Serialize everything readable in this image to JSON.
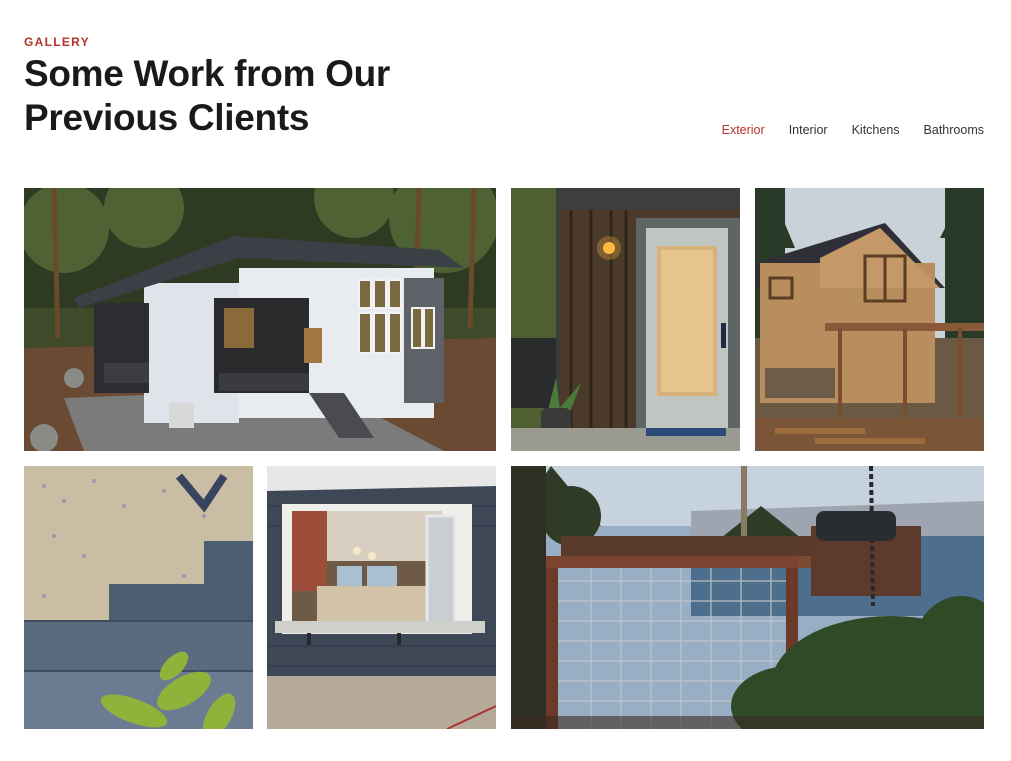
{
  "gallery": {
    "eyebrow": "GALLERY",
    "title_line1": "Some Work from Our",
    "title_line2": "Previous Clients",
    "filters": [
      {
        "label": "Exterior",
        "active": true
      },
      {
        "label": "Interior",
        "active": false
      },
      {
        "label": "Kitchens",
        "active": false
      },
      {
        "label": "Bathrooms",
        "active": false
      }
    ]
  },
  "colors": {
    "accent": "#b5312b",
    "heading": "#1a1a1a"
  }
}
